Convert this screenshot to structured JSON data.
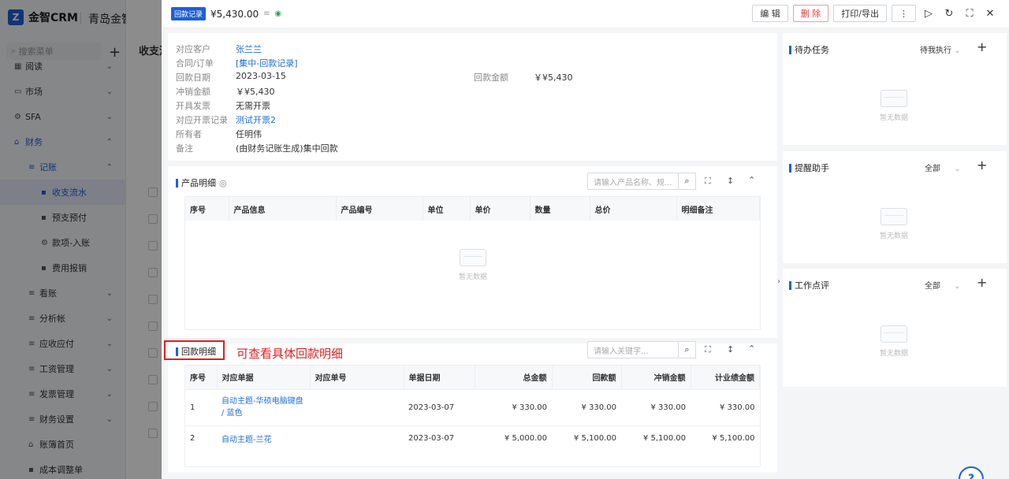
{
  "app": {
    "logo_text": "金智CRM",
    "company": "青岛金智公司",
    "menu_search_placeholder": "搜索菜单",
    "nav": [
      {
        "label": "阅读",
        "icon": "grid-icon"
      },
      {
        "label": "市场",
        "icon": "calendar-icon"
      },
      {
        "label": "SFA",
        "icon": "gear-icon"
      },
      {
        "label": "财务",
        "icon": "home-icon"
      },
      {
        "label": "记账",
        "icon": "list-icon"
      },
      {
        "label": "收支流水",
        "icon": "file-icon"
      },
      {
        "label": "预支预付",
        "icon": "doc-icon"
      },
      {
        "label": "款项-入账",
        "icon": "gear-icon"
      },
      {
        "label": "费用报销",
        "icon": "doc-icon"
      },
      {
        "label": "看账",
        "icon": "list-icon"
      },
      {
        "label": "分析帐",
        "icon": "list-icon"
      },
      {
        "label": "应收应付",
        "icon": "list-icon"
      },
      {
        "label": "工资管理",
        "icon": "list-icon"
      },
      {
        "label": "发票管理",
        "icon": "list-icon"
      },
      {
        "label": "财务设置",
        "icon": "list-icon"
      },
      {
        "label": "账簿首页",
        "icon": "home-icon"
      },
      {
        "label": "成本调整单",
        "icon": "doc-icon"
      }
    ],
    "main_title": "收支流"
  },
  "drawer": {
    "tag": "回款记录",
    "amount": "¥5,430.00",
    "actions": {
      "edit": "编 辑",
      "delete": "删 除",
      "print": "打印/导出",
      "more": "⋮"
    },
    "info": [
      {
        "label": "对应客户",
        "value": "张兰兰",
        "link": true
      },
      {
        "label": "合同/订单",
        "value": "[集中-回款记录]",
        "link": true
      },
      {
        "label": "回款日期",
        "value": "2023-03-15",
        "link": false
      },
      {
        "label": "冲销金额",
        "value": "￥¥5,430",
        "link": false
      },
      {
        "label": "开具发票",
        "value": "无需开票",
        "link": false
      },
      {
        "label": "对应开票记录",
        "value": "测试开票2",
        "link": true
      },
      {
        "label": "所有者",
        "value": "任明伟",
        "link": false
      },
      {
        "label": "备注",
        "value": "(由财务记账生成)集中回款",
        "link": false
      }
    ],
    "info_right": {
      "label": "回款金额",
      "value": "￥¥5,430"
    },
    "product": {
      "title": "产品明细",
      "search_placeholder": "请输入产品名称、规...",
      "columns": [
        "序号",
        "产品信息",
        "产品编号",
        "单位",
        "单价",
        "数量",
        "总价",
        "明细备注"
      ],
      "empty": "暂无数据"
    },
    "payment": {
      "title": "回款明细",
      "search_placeholder": "请输入关键字...",
      "columns": [
        "序号",
        "对应单据",
        "对应单号",
        "单据日期",
        "总金额",
        "回款额",
        "冲销金额",
        "计业绩金额"
      ],
      "rows": [
        {
          "no": "1",
          "doc": "自动主题-华硕电脑键盘 / 蓝色",
          "doc_no": "",
          "date": "2023-03-07",
          "total": "¥ 330.00",
          "paid": "¥ 330.00",
          "offset": "¥ 330.00",
          "perf": "¥ 330.00"
        },
        {
          "no": "2",
          "doc": "自动主题-兰花",
          "doc_no": "",
          "date": "2023-03-07",
          "total": "¥ 5,000.00",
          "paid": "¥ 5,100.00",
          "offset": "¥ 5,100.00",
          "perf": "¥ 5,100.00"
        }
      ]
    },
    "side": [
      {
        "title": "待办任务",
        "filter": "待我执行",
        "empty": "暂无数据"
      },
      {
        "title": "提醒助手",
        "filter": "全部",
        "empty": "暂无数据"
      },
      {
        "title": "工作点评",
        "filter": "全部",
        "empty": "暂无数据"
      }
    ],
    "annotation": "可查看具体回款明细"
  }
}
